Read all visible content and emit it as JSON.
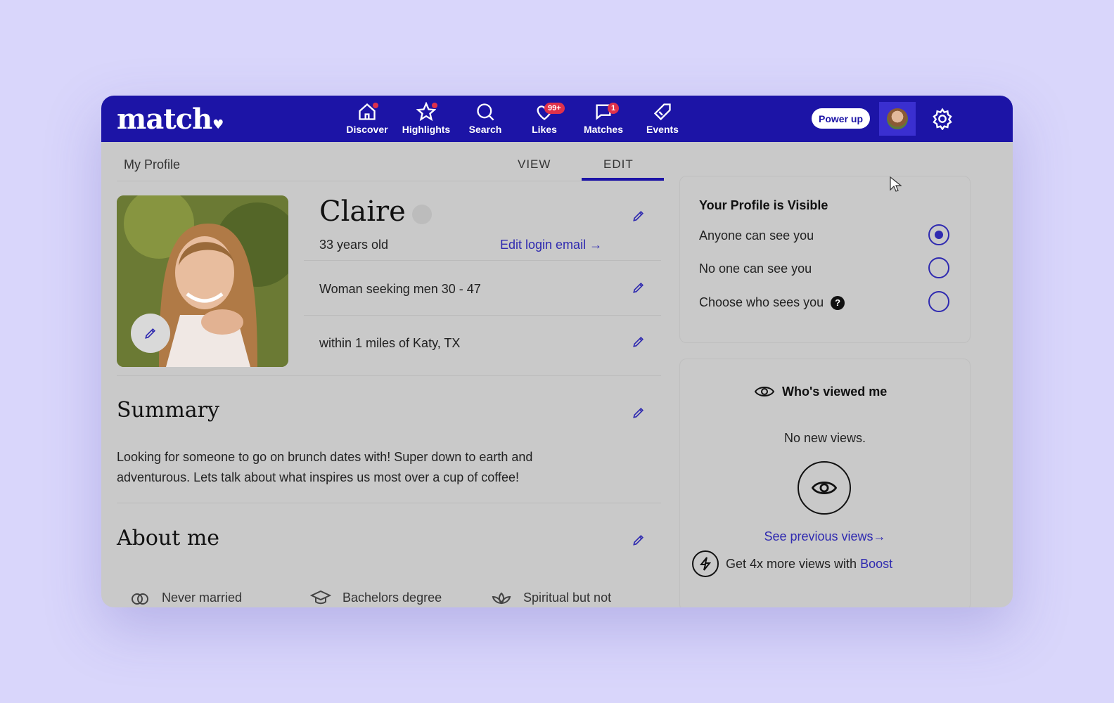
{
  "app": {
    "logo": "match"
  },
  "nav": [
    {
      "label": "Discover",
      "icon": "home-icon",
      "indicator": "dot"
    },
    {
      "label": "Highlights",
      "icon": "star-icon",
      "indicator": "dot"
    },
    {
      "label": "Search",
      "icon": "search-icon",
      "indicator": ""
    },
    {
      "label": "Likes",
      "icon": "heart-icon",
      "indicator": "99+"
    },
    {
      "label": "Matches",
      "icon": "chat-icon",
      "indicator": "1"
    },
    {
      "label": "Events",
      "icon": "tag-icon",
      "indicator": ""
    }
  ],
  "header": {
    "power_up": "Power up"
  },
  "subheader": {
    "title": "My Profile",
    "tab_view": "VIEW",
    "tab_edit": "EDIT",
    "active_tab": "EDIT"
  },
  "profile": {
    "name": "Claire",
    "age": "33 years old",
    "edit_email": "Edit login email →",
    "seeking": "Woman seeking men 30 - 47",
    "location": "within 1 miles of Katy, TX"
  },
  "summary": {
    "title": "Summary",
    "text": "Looking for someone to go on brunch dates with! Super down to earth and adventurous. Lets talk about what inspires us most over a cup of coffee!"
  },
  "about": {
    "title": "About me",
    "items": [
      "Never married",
      "Bachelors degree",
      "Spiritual but not"
    ]
  },
  "visibility": {
    "title": "Your Profile is Visible",
    "options": [
      "Anyone can see you",
      "No one can see you",
      "Choose who sees you"
    ],
    "selected": "Anyone can see you",
    "help": "?"
  },
  "viewed": {
    "title": "Who's viewed me",
    "status": "No new views.",
    "previous": "See previous views→",
    "boost_text": "Get 4x more views with",
    "boost_link": "Boost"
  },
  "colors": {
    "brand": "#1c14a6",
    "accent": "#2f2ab0",
    "badge": "#e0314b"
  }
}
